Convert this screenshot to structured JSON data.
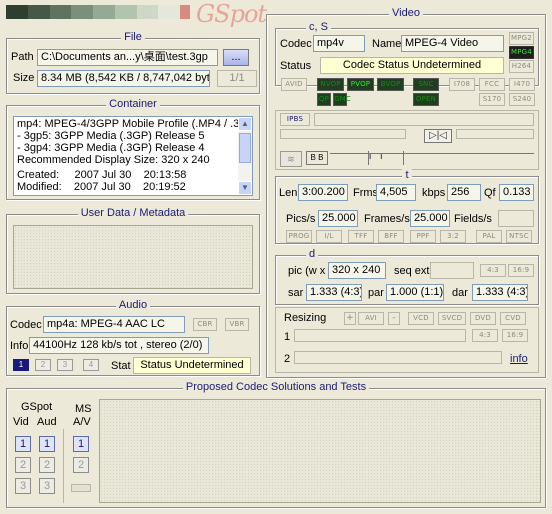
{
  "header": {
    "logo_text": "GSpot",
    "swatches": [
      "#2f3f2f",
      "#465846",
      "#5f735f",
      "#7a907a",
      "#95aa95",
      "#b2c3ae",
      "#cfd8c6",
      "#e4e8da",
      "#d98a7e"
    ]
  },
  "file": {
    "title": "File",
    "path_label": "Path",
    "path_value": "C:\\Documents an...y\\桌面\\test.3gp",
    "browse_label": "...",
    "size_label": "Size",
    "size_value": "8.34 MB (8,542 KB / 8,747,042 byte",
    "page_indicator": "1/1"
  },
  "container": {
    "title": "Container",
    "lines": [
      "mp4: MPEG-4/3GPP Mobile Profile (.MP4 / .3",
      "- 3gp5: 3GPP Media (.3GP) Release 5",
      "- 3gp4: 3GPP Media (.3GP) Release 4",
      "Recommended Display Size: 320 x 240",
      "Created:     2007 Jul 30    20:13:58",
      "Modified:    2007 Jul 30    20:19:52"
    ]
  },
  "userdata": {
    "title": "User Data / Metadata"
  },
  "audio": {
    "title": "Audio",
    "codec_label": "Codec",
    "codec_value": "mp4a: MPEG-4 AAC LC",
    "cbr_label": "CBR",
    "vbr_label": "VBR",
    "info_label": "Info",
    "info_value": "44100Hz  128 kb/s tot , stereo (2/0)",
    "streams": [
      "1",
      "2",
      "3",
      "4"
    ],
    "stat_label": "Stat",
    "stat_value": "Status Undetermined"
  },
  "video": {
    "title": "Video",
    "cs_title": "c, S",
    "codec_label": "Codec",
    "codec_value": "mp4v",
    "name_label": "Name",
    "name_value": "MPEG-4 Video",
    "mpeg_flags": [
      "MPG2",
      "MPG4",
      "H264"
    ],
    "status_label": "Status",
    "status_value": "Codec Status Undetermined",
    "avid": "AVID",
    "vop_flags": [
      "NVOP",
      "PVOP",
      "BVOP"
    ],
    "gmc_flags": [
      "QP",
      "GMC"
    ],
    "snc_flags": [
      "SNC",
      "OPEN"
    ],
    "std_flags": [
      "I708",
      "FCC",
      "I470",
      "S170",
      "S240"
    ],
    "ipbs": "IPBS",
    "bb": "B B",
    "ii": "I    I",
    "t_title": "t",
    "len_label": "Len",
    "len_value": "3:00.200",
    "frms_label": "Frms",
    "frms_value": "4,505",
    "kbps_label": "kbps",
    "kbps_value": "256",
    "qf_label": "Qf",
    "qf_value": "0.133",
    "pics_label": "Pics/s",
    "pics_value": "25.000",
    "frames_label": "Frames/s",
    "frames_value": "25.000",
    "fields_label": "Fields/s",
    "scan_flags": [
      "PROG",
      "I/L",
      "TFF",
      "BFF",
      "PPF",
      "3:2",
      "PAL",
      "NTSC"
    ],
    "d_title": "d",
    "pic_label": "pic (w x",
    "pic_value": "320 x 240",
    "seqext_label": "seq ext",
    "aspect_flags": [
      "4:3",
      "16:9"
    ],
    "sar_label": "sar",
    "sar_value": "1.333 (4:3)",
    "par_label": "par",
    "par_value": "1.000 (1:1)",
    "dar_label": "dar",
    "dar_value": "1.333 (4:3)",
    "resizing_label": "Resizing",
    "resize_flags": [
      "+",
      "AVI",
      "-",
      "VCD",
      "SVCD",
      "DVD",
      "CVD"
    ],
    "row1_label": "1",
    "row2_label": "2",
    "row1_flags": [
      "4:3",
      "16:9"
    ],
    "info_link": "info"
  },
  "proposed": {
    "title": "Proposed Codec Solutions and Tests",
    "gspot_label": "GSpot",
    "ms_label": "MS",
    "vid_label": "Vid",
    "aud_label": "Aud",
    "av_label": "A/V",
    "nums": [
      "1",
      "2",
      "3"
    ]
  }
}
